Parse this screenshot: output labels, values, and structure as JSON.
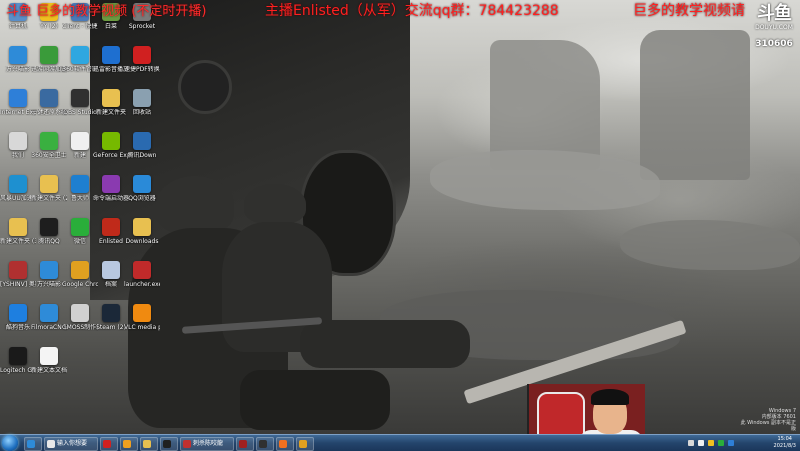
{
  "stream_overlay": {
    "left_text": "斗鱼 巨多的教学视频 (不定时开播)",
    "mid_text": "主播Enlisted（从军）交流qq群：784423288",
    "right_text": "巨多的教学视频请",
    "platform_logo": "斗鱼",
    "platform_sub": "DOUYU.COM",
    "room_number": "310606"
  },
  "desktop_icons": [
    {
      "label": "计算机",
      "icon": "computer-icon",
      "color": "#5a8fc9"
    },
    {
      "label": "YY (2)",
      "icon": "yy-icon",
      "color": "#f0c020"
    },
    {
      "label": "Client - 快捷方式",
      "icon": "client-icon",
      "color": "#4a7ab8"
    },
    {
      "label": "白菜",
      "icon": "cabbage-icon",
      "color": "#6a9a40"
    },
    {
      "label": "Sprocket",
      "icon": "sprocket-icon",
      "color": "#7a7a7a"
    },
    {
      "label": "万兴喵影",
      "icon": "filmora-icon",
      "color": "#2e8bd8"
    },
    {
      "label": "迅游网游加速器",
      "icon": "xunyou-icon",
      "color": "#3a9b3a"
    },
    {
      "label": "360软件管家",
      "icon": "softmgr-icon",
      "color": "#2fa7e0"
    },
    {
      "label": "迅雷影音播放器",
      "icon": "player-icon",
      "color": "#1e6fd0"
    },
    {
      "label": "速捷PDF转换器",
      "icon": "pdf-icon",
      "color": "#d02020"
    },
    {
      "label": "Internet Explorer",
      "icon": "ie-icon",
      "color": "#2e7fd8"
    },
    {
      "label": "一键还原系统",
      "icon": "restore-icon",
      "color": "#3a6aa0"
    },
    {
      "label": "OBS Studio",
      "icon": "obs-icon",
      "color": "#303030"
    },
    {
      "label": "新建文件夹",
      "icon": "folder-icon",
      "color": "#e8c050"
    },
    {
      "label": "回收站",
      "icon": "recycle-bin-icon",
      "color": "#8aa0b0"
    },
    {
      "label": "我们",
      "icon": "document-icon",
      "color": "#d8d8d8"
    },
    {
      "label": "360安全卫士",
      "icon": "security-icon",
      "color": "#3ab040"
    },
    {
      "label": "新建",
      "icon": "document-icon",
      "color": "#f0f0f0"
    },
    {
      "label": "GeForce Experience",
      "icon": "geforce-icon",
      "color": "#76b900"
    },
    {
      "label": "腾讯Down",
      "icon": "tencent-icon",
      "color": "#2a6ab0"
    },
    {
      "label": "风暴UU加速器",
      "icon": "uu-icon",
      "color": "#1e90d0"
    },
    {
      "label": "新建文件夹 (2)",
      "icon": "folder-icon",
      "color": "#e8c050"
    },
    {
      "label": "鲁大师",
      "icon": "ludashi-icon",
      "color": "#1e7fd0"
    },
    {
      "label": "命令端启动器",
      "icon": "launcher-icon",
      "color": "#8a3ab0"
    },
    {
      "label": "QQ浏览器",
      "icon": "qqbrowser-icon",
      "color": "#2a8ad8"
    },
    {
      "label": "新建文件夹 (3)",
      "icon": "folder-icon",
      "color": "#e8c050"
    },
    {
      "label": "腾讯QQ",
      "icon": "qq-icon",
      "color": "#1e1e1e"
    },
    {
      "label": "微信",
      "icon": "wechat-icon",
      "color": "#2aae3a"
    },
    {
      "label": "Enlisted",
      "icon": "enlisted-icon",
      "color": "#c02a1a"
    },
    {
      "label": "Downloads",
      "icon": "folder-icon",
      "color": "#e8c050"
    },
    {
      "label": "[YSHINV] 奥斯战地模式",
      "icon": "game-icon",
      "color": "#b03030"
    },
    {
      "label": "万兴喵影",
      "icon": "filmora-icon",
      "color": "#2e8bd8"
    },
    {
      "label": "Google Chrome",
      "icon": "chrome-icon",
      "color": "#e0a020"
    },
    {
      "label": "档案",
      "icon": "document-icon",
      "color": "#b8c8e0"
    },
    {
      "label": "launcher.exe",
      "icon": "launcher-exe-icon",
      "color": "#c02a2a"
    },
    {
      "label": "酷狗音乐",
      "icon": "kugou-icon",
      "color": "#1e7fe0"
    },
    {
      "label": "FilmoraCN 快捷方式",
      "icon": "filmora-icon",
      "color": "#2e8bd8"
    },
    {
      "label": "GMOSS制作器",
      "icon": "gmoss-icon",
      "color": "#d0d0d0"
    },
    {
      "label": "Steam (2)",
      "icon": "steam-icon",
      "color": "#1b2838"
    },
    {
      "label": "VLC media player",
      "icon": "vlc-icon",
      "color": "#f08a10"
    },
    {
      "label": "Logitech G HUB",
      "icon": "logitech-icon",
      "color": "#1a1a1a"
    },
    {
      "label": "新建文本文档",
      "icon": "text-file-icon",
      "color": "#f4f4f4"
    }
  ],
  "taskbar": {
    "items": [
      {
        "label": "",
        "icon": "browser-icon",
        "color": "#2e8bd8"
      },
      {
        "label": "输入你想要",
        "icon": "search-icon",
        "color": "#e8e8e8"
      },
      {
        "label": "",
        "icon": "player-icon",
        "color": "#d02020"
      },
      {
        "label": "",
        "icon": "chat-icon",
        "color": "#f0a020"
      },
      {
        "label": "",
        "icon": "folder-icon",
        "color": "#e8c050"
      },
      {
        "label": "",
        "icon": "qq-icon",
        "color": "#202020"
      },
      {
        "label": "刺杀陈咬龍",
        "icon": "game-icon",
        "color": "#c03030"
      },
      {
        "label": "",
        "icon": "enlisted-icon",
        "color": "#a02020"
      },
      {
        "label": "",
        "icon": "obs-icon",
        "color": "#303030"
      },
      {
        "label": "",
        "icon": "douyu-icon",
        "color": "#f07020"
      },
      {
        "label": "",
        "icon": "chrome-icon",
        "color": "#e0a020"
      }
    ],
    "clock_time": "15:04",
    "clock_date": "2021/8/3",
    "watermark": [
      "Windows 7",
      "内部版本 7601",
      "此 Windows 副本不是正版"
    ]
  }
}
